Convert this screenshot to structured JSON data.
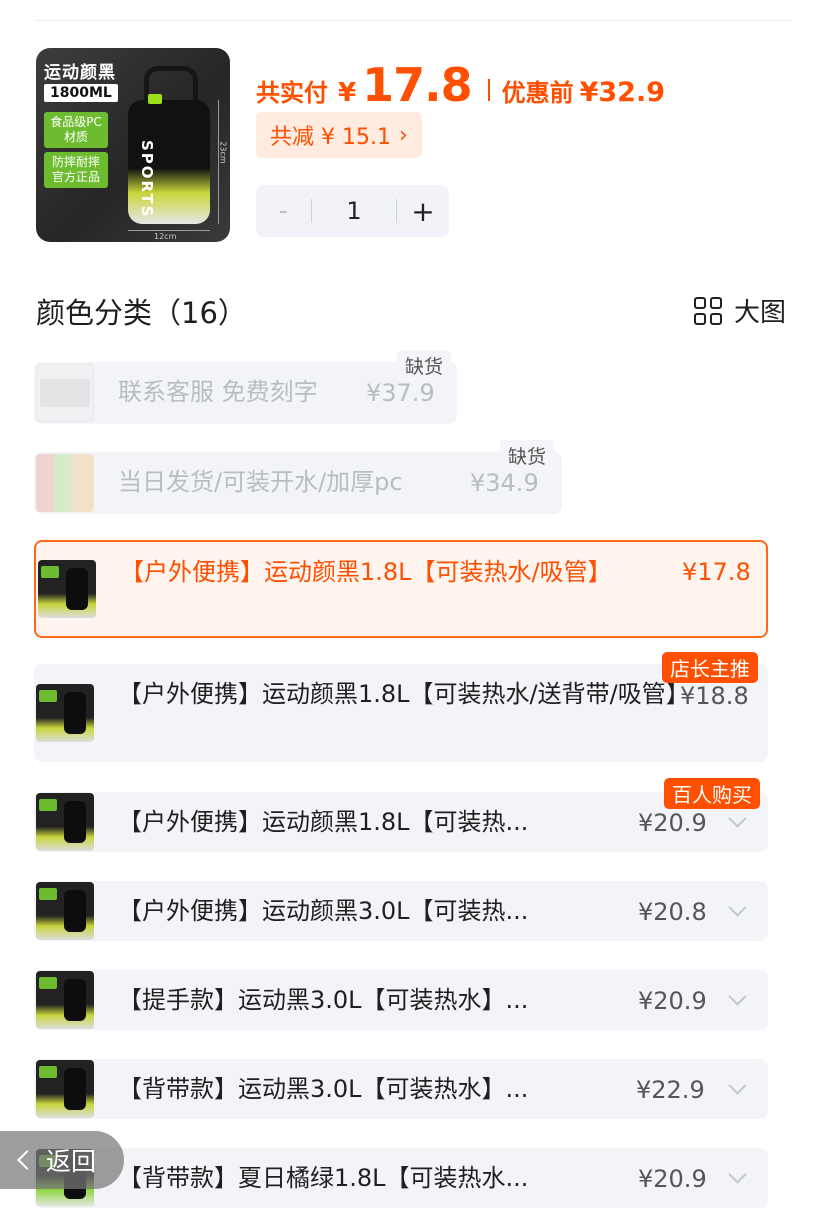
{
  "product_image": {
    "title": "运动颜黑",
    "capacity": "1800ML",
    "tag1": "食品级PC材质",
    "tag2": "防摔耐摔官方正品",
    "bottle_text": "SPORTS",
    "height_dim": "23cm",
    "width_dim": "12cm"
  },
  "price": {
    "paid_label": "共实付",
    "currency": "¥",
    "paid_value": "17.8",
    "original_label": "优惠前",
    "original_value": "¥32.9",
    "discount_text": "共减 ¥ 15.1",
    "discount_chevron": "›"
  },
  "quantity": {
    "minus": "-",
    "value": "1",
    "plus": "+"
  },
  "section": {
    "title": "颜色分类（16）",
    "view_label": "大图"
  },
  "options": [
    {
      "text": "联系客服 免费刻字",
      "price": "¥37.9",
      "badge": "缺货",
      "state": "disabled"
    },
    {
      "text": "当日发货/可装开水/加厚pc",
      "price": "¥34.9",
      "badge": "缺货",
      "state": "disabled"
    },
    {
      "text": "【户外便携】运动颜黑1.8L【可装热水/吸管】",
      "price": "¥17.8",
      "badge": "",
      "state": "selected"
    },
    {
      "text": "【户外便携】运动颜黑1.8L【可装热水/送背带/吸管】",
      "price": "¥18.8",
      "badge": "店长主推",
      "state": "normal"
    },
    {
      "text": "【户外便携】运动颜黑1.8L【可装热...",
      "price": "¥20.9",
      "badge": "百人购买",
      "state": "normal"
    },
    {
      "text": "【户外便携】运动颜黑3.0L【可装热...",
      "price": "¥20.8",
      "badge": "",
      "state": "normal"
    },
    {
      "text": "【提手款】运动黑3.0L【可装热水】...",
      "price": "¥20.9",
      "badge": "",
      "state": "normal"
    },
    {
      "text": "【背带款】运动黑3.0L【可装热水】...",
      "price": "¥22.9",
      "badge": "",
      "state": "normal"
    },
    {
      "text": "【背带款】夏日橘绿1.8L【可装热水...",
      "price": "¥20.9",
      "badge": "",
      "state": "normal"
    }
  ],
  "back_label": "返回",
  "colors": {
    "accent": "#ff4f00",
    "selected_border": "#ff6a1a",
    "row_bg": "#f2f4f8"
  }
}
